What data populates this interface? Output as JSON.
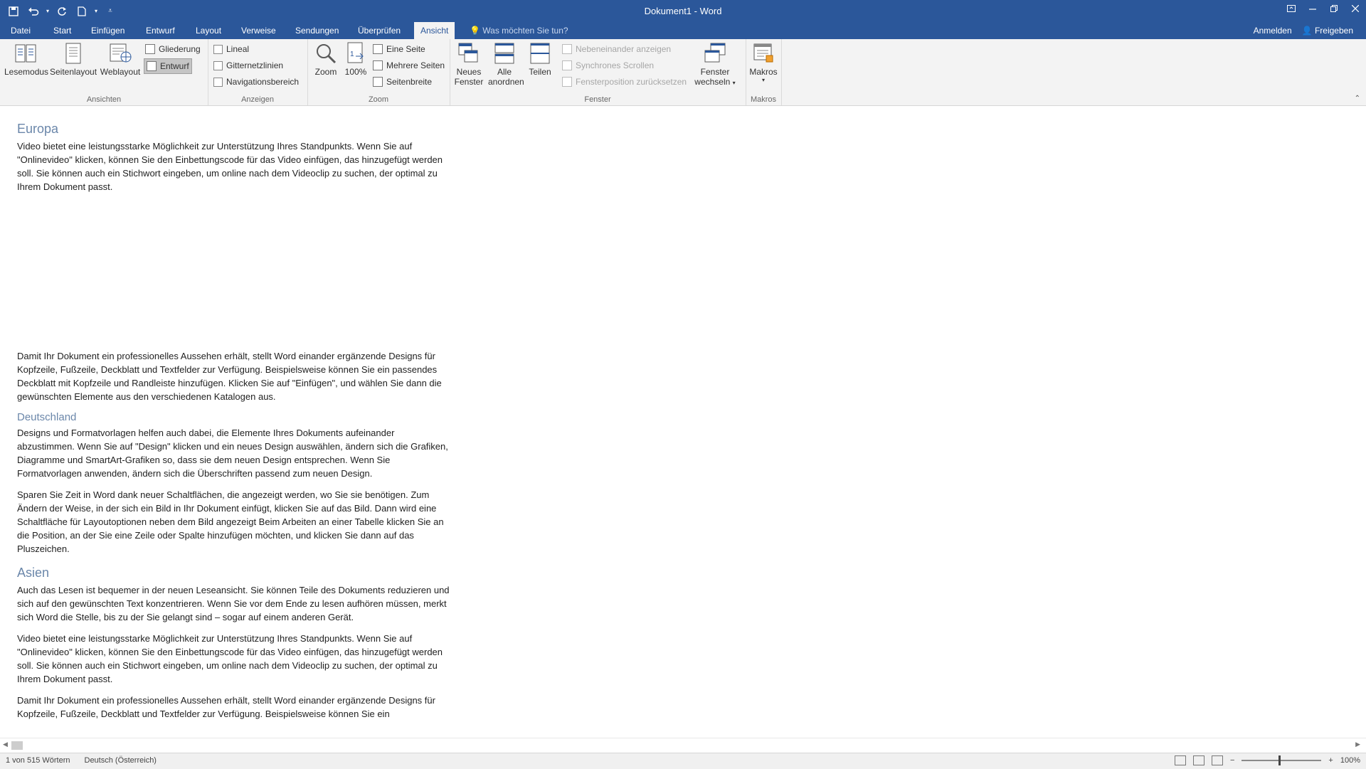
{
  "window": {
    "title": "Dokument1 - Word"
  },
  "qat": {
    "save_icon": "save-icon",
    "undo_icon": "undo-icon",
    "redo_icon": "redo-icon",
    "new_icon": "new-document-icon",
    "customize_icon": "customize-icon"
  },
  "tabs": [
    {
      "label": "Datei"
    },
    {
      "label": "Start"
    },
    {
      "label": "Einfügen"
    },
    {
      "label": "Entwurf"
    },
    {
      "label": "Layout"
    },
    {
      "label": "Verweise"
    },
    {
      "label": "Sendungen"
    },
    {
      "label": "Überprüfen"
    },
    {
      "label": "Ansicht",
      "active": true
    }
  ],
  "tellme": {
    "placeholder": "Was möchten Sie tun?"
  },
  "account": {
    "signin": "Anmelden",
    "share": "Freigeben"
  },
  "ribbon": {
    "ansichten": {
      "label": "Ansichten",
      "lesemodus": "Lesemodus",
      "seitenlayout": "Seitenlayout",
      "weblayout": "Weblayout",
      "gliederung": "Gliederung",
      "entwurf": "Entwurf"
    },
    "anzeigen": {
      "label": "Anzeigen",
      "lineal": "Lineal",
      "gitternetzlinien": "Gitternetzlinien",
      "navigationsbereich": "Navigationsbereich"
    },
    "zoom": {
      "label": "Zoom",
      "zoom": "Zoom",
      "percent": "100%",
      "eine_seite": "Eine Seite",
      "mehrere_seiten": "Mehrere Seiten",
      "seitenbreite": "Seitenbreite"
    },
    "fenster": {
      "label": "Fenster",
      "neues_fenster_1": "Neues",
      "neues_fenster_2": "Fenster",
      "alle_anordnen_1": "Alle",
      "alle_anordnen_2": "anordnen",
      "teilen": "Teilen",
      "nebeneinander": "Nebeneinander anzeigen",
      "synchrones": "Synchrones Scrollen",
      "fensterposition": "Fensterposition zurücksetzen",
      "fenster_wechseln_1": "Fenster",
      "fenster_wechseln_2": "wechseln"
    },
    "makros": {
      "label": "Makros",
      "makros": "Makros"
    }
  },
  "document": {
    "h_europa": "Europa",
    "p1": "Video bietet eine leistungsstarke Möglichkeit zur Unterstützung Ihres Standpunkts. Wenn Sie auf \"Onlinevideo\" klicken, können Sie den Einbettungscode für das Video einfügen, das hinzugefügt werden soll. Sie können auch ein Stichwort eingeben, um online nach dem Videoclip zu suchen, der optimal zu Ihrem Dokument passt.",
    "p2": "Damit Ihr Dokument ein professionelles Aussehen erhält, stellt Word einander ergänzende Designs für Kopfzeile, Fußzeile, Deckblatt und Textfelder zur Verfügung. Beispielsweise können Sie ein passendes Deckblatt mit Kopfzeile und Randleiste hinzufügen. Klicken Sie auf \"Einfügen\", und wählen Sie dann die gewünschten Elemente aus den verschiedenen Katalogen aus.",
    "h_deutschland": "Deutschland",
    "p3": "Designs und Formatvorlagen helfen auch dabei, die Elemente Ihres Dokuments aufeinander abzustimmen. Wenn Sie auf \"Design\" klicken und ein neues Design auswählen, ändern sich die Grafiken, Diagramme und SmartArt-Grafiken so, dass sie dem neuen Design entsprechen. Wenn Sie Formatvorlagen anwenden, ändern sich die Überschriften passend zum neuen Design.",
    "p4": "Sparen Sie Zeit in Word dank neuer Schaltflächen, die angezeigt werden, wo Sie sie benötigen. Zum Ändern der Weise, in der sich ein Bild in Ihr Dokument einfügt, klicken Sie auf das Bild. Dann wird eine Schaltfläche für Layoutoptionen neben dem Bild angezeigt Beim Arbeiten an einer Tabelle klicken Sie an die Position, an der Sie eine Zeile oder Spalte hinzufügen möchten, und klicken Sie dann auf das Pluszeichen.",
    "h_asien": "Asien",
    "p5": "Auch das Lesen ist bequemer in der neuen Leseansicht. Sie können Teile des Dokuments reduzieren und sich auf den gewünschten Text konzentrieren. Wenn Sie vor dem Ende zu lesen aufhören müssen, merkt sich Word die Stelle, bis zu der Sie gelangt sind – sogar auf einem anderen Gerät.",
    "p6": "Video bietet eine leistungsstarke Möglichkeit zur Unterstützung Ihres Standpunkts. Wenn Sie auf \"Onlinevideo\" klicken, können Sie den Einbettungscode für das Video einfügen, das hinzugefügt werden soll. Sie können auch ein Stichwort eingeben, um online nach dem Videoclip zu suchen, der optimal zu Ihrem Dokument passt.",
    "p7": "Damit Ihr Dokument ein professionelles Aussehen erhält, stellt Word einander ergänzende Designs für Kopfzeile, Fußzeile, Deckblatt und Textfelder zur Verfügung. Beispielsweise können Sie ein"
  },
  "status": {
    "words": "1 von 515 Wörtern",
    "language": "Deutsch (Österreich)",
    "zoom": "100%"
  },
  "colors": {
    "accent": "#2b579a",
    "heading": "#6b87aa"
  }
}
